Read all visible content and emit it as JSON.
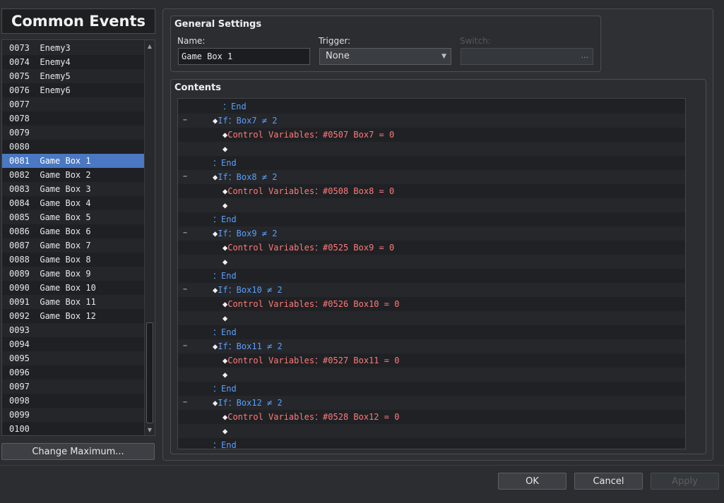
{
  "panel_title": "Common Events",
  "events": [
    "0073  Enemy3",
    "0074  Enemy4",
    "0075  Enemy5",
    "0076  Enemy6",
    "0077",
    "0078",
    "0079",
    "0080",
    "0081  Game Box 1",
    "0082  Game Box 2",
    "0083  Game Box 3",
    "0084  Game Box 4",
    "0085  Game Box 5",
    "0086  Game Box 6",
    "0087  Game Box 7",
    "0088  Game Box 8",
    "0089  Game Box 9",
    "0090  Game Box 10",
    "0091  Game Box 11",
    "0092  Game Box 12",
    "0093",
    "0094",
    "0095",
    "0096",
    "0097",
    "0098",
    "0099",
    "0100"
  ],
  "selected_event_index": 8,
  "change_max_label": "Change Maximum...",
  "general": {
    "title": "General Settings",
    "name_label": "Name:",
    "name_value": "Game Box 1",
    "trigger_label": "Trigger:",
    "trigger_value": "None",
    "switch_label": "Switch:",
    "switch_button": "..."
  },
  "contents_title": "Contents",
  "commands": [
    {
      "indent": 1,
      "parts": [
        [
          "blue",
          "：End"
        ]
      ]
    },
    {
      "collapse": true,
      "indent": 0,
      "parts": [
        [
          "white",
          "◆"
        ],
        [
          "blue",
          "If：Box7 ≠ 2"
        ]
      ]
    },
    {
      "indent": 1,
      "parts": [
        [
          "white",
          "◆"
        ],
        [
          "red",
          "Control Variables：#0507 Box7 = 0"
        ]
      ]
    },
    {
      "indent": 1,
      "parts": [
        [
          "white",
          "◆"
        ]
      ]
    },
    {
      "indent": 0,
      "parts": [
        [
          "blue",
          "：End"
        ]
      ]
    },
    {
      "collapse": true,
      "indent": 0,
      "parts": [
        [
          "white",
          "◆"
        ],
        [
          "blue",
          "If：Box8 ≠ 2"
        ]
      ]
    },
    {
      "indent": 1,
      "parts": [
        [
          "white",
          "◆"
        ],
        [
          "red",
          "Control Variables：#0508 Box8 = 0"
        ]
      ]
    },
    {
      "indent": 1,
      "parts": [
        [
          "white",
          "◆"
        ]
      ]
    },
    {
      "indent": 0,
      "parts": [
        [
          "blue",
          "：End"
        ]
      ]
    },
    {
      "collapse": true,
      "indent": 0,
      "parts": [
        [
          "white",
          "◆"
        ],
        [
          "blue",
          "If：Box9 ≠ 2"
        ]
      ]
    },
    {
      "indent": 1,
      "parts": [
        [
          "white",
          "◆"
        ],
        [
          "red",
          "Control Variables：#0525 Box9 = 0"
        ]
      ]
    },
    {
      "indent": 1,
      "parts": [
        [
          "white",
          "◆"
        ]
      ]
    },
    {
      "indent": 0,
      "parts": [
        [
          "blue",
          "：End"
        ]
      ]
    },
    {
      "collapse": true,
      "indent": 0,
      "parts": [
        [
          "white",
          "◆"
        ],
        [
          "blue",
          "If：Box10 ≠ 2"
        ]
      ]
    },
    {
      "indent": 1,
      "parts": [
        [
          "white",
          "◆"
        ],
        [
          "red",
          "Control Variables：#0526 Box10 = 0"
        ]
      ]
    },
    {
      "indent": 1,
      "parts": [
        [
          "white",
          "◆"
        ]
      ]
    },
    {
      "indent": 0,
      "parts": [
        [
          "blue",
          "：End"
        ]
      ]
    },
    {
      "collapse": true,
      "indent": 0,
      "parts": [
        [
          "white",
          "◆"
        ],
        [
          "blue",
          "If：Box11 ≠ 2"
        ]
      ]
    },
    {
      "indent": 1,
      "parts": [
        [
          "white",
          "◆"
        ],
        [
          "red",
          "Control Variables：#0527 Box11 = 0"
        ]
      ]
    },
    {
      "indent": 1,
      "parts": [
        [
          "white",
          "◆"
        ]
      ]
    },
    {
      "indent": 0,
      "parts": [
        [
          "blue",
          "：End"
        ]
      ]
    },
    {
      "collapse": true,
      "indent": 0,
      "parts": [
        [
          "white",
          "◆"
        ],
        [
          "blue",
          "If：Box12 ≠ 2"
        ]
      ]
    },
    {
      "indent": 1,
      "parts": [
        [
          "white",
          "◆"
        ],
        [
          "red",
          "Control Variables：#0528 Box12 = 0"
        ]
      ]
    },
    {
      "indent": 1,
      "parts": [
        [
          "white",
          "◆"
        ]
      ]
    },
    {
      "indent": 0,
      "parts": [
        [
          "blue",
          "：End"
        ]
      ]
    }
  ],
  "buttons": {
    "ok": "OK",
    "cancel": "Cancel",
    "apply": "Apply"
  },
  "icons": {
    "scroll_up": "▲",
    "scroll_down": "▼",
    "dropdown": "▼",
    "collapse": "−"
  },
  "colors": {
    "selection": "#4a78c2",
    "command_blue": "#5a9fff",
    "command_red": "#ff7a7a"
  }
}
